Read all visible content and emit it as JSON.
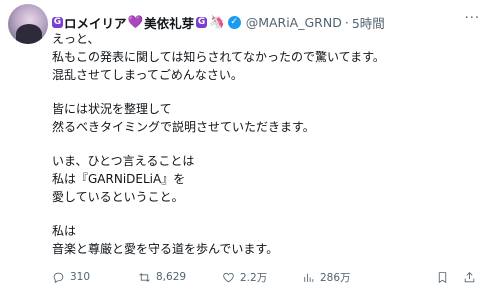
{
  "author": {
    "name_prefix": "G",
    "name": "ロメイリア",
    "name_suffix": "美依礼芽",
    "name_tail": "G",
    "handle": "@MARiA_GRND",
    "time": "5時間"
  },
  "body": [
    [
      "えっと、",
      "私もこの発表に関しては知らされてなかったので驚いてます。",
      "混乱させてしまってごめんなさい。"
    ],
    [
      "皆には状況を整理して",
      "然るべきタイミングで説明させていただきます。"
    ],
    [
      "いま、ひとつ言えることは",
      "私は『GARNiDELiA』を",
      "愛しているということ。"
    ],
    [
      "私は",
      "音楽と尊厳と愛を守る道を歩んでいます。"
    ]
  ],
  "stats": {
    "replies": "310",
    "reposts": "8,629",
    "likes": "2.2万",
    "views": "286万"
  },
  "icons": [
    "reply-icon",
    "repost-icon",
    "like-icon",
    "views-icon",
    "bookmark-icon",
    "share-icon",
    "more-icon",
    "verified-icon"
  ]
}
